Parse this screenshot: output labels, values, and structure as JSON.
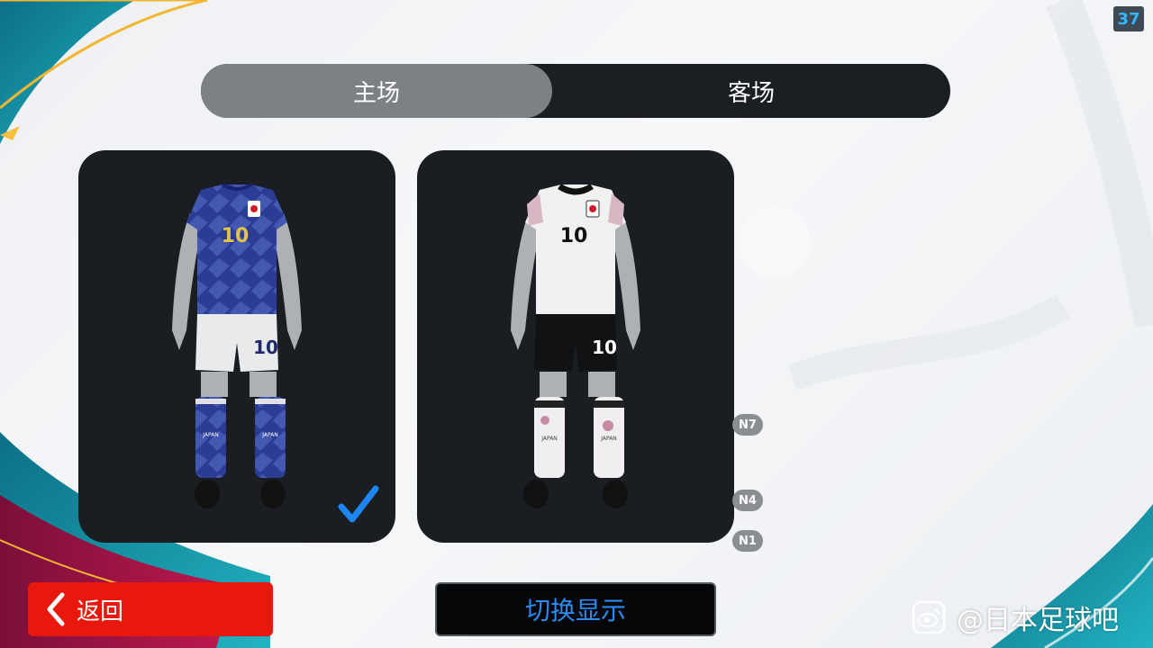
{
  "counter": "37",
  "tabs": {
    "home_label": "主场",
    "away_label": "客场",
    "selected": "home"
  },
  "kits": {
    "home": {
      "number": "10",
      "crest": "JFA",
      "socks_text": "JAPAN",
      "selected": true
    },
    "away": {
      "number": "10",
      "crest": "JFA",
      "socks_text": "JAPAN",
      "selected": false
    }
  },
  "markers": [
    "N7",
    "N4",
    "N1"
  ],
  "footer": {
    "back_label": "返回",
    "switch_label": "切换显示"
  },
  "watermark": {
    "text": "@日本足球吧"
  },
  "colors": {
    "accent_blue": "#2b8bf0",
    "back_red": "#e8180c",
    "card_bg": "#1a1d22",
    "home_shirt": "#2a3c96"
  }
}
